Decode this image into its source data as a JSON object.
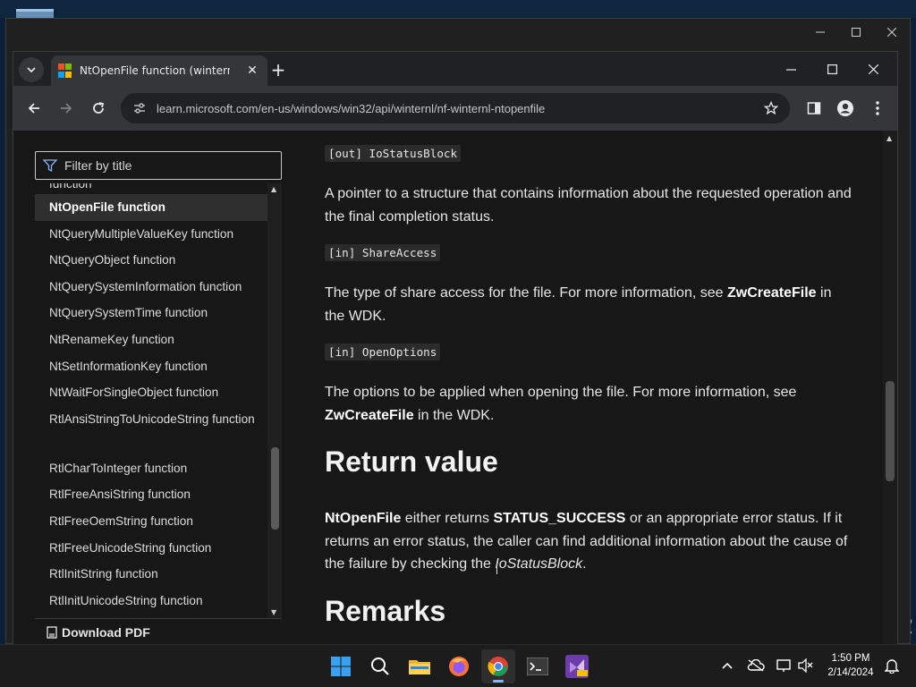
{
  "outer_window": {
    "controls": [
      "minimize-icon",
      "maximize-icon",
      "close-icon"
    ]
  },
  "browser": {
    "tab": {
      "title": "NtOpenFile function (winternl.h)",
      "close_glyph": "✕"
    },
    "new_tab_glyph": "+",
    "address": {
      "url": "learn.microsoft.com/en-us/windows/win32/api/winternl/nf-winternl-ntopenfile"
    }
  },
  "sidebar": {
    "filter_placeholder": "Filter by title",
    "items": [
      {
        "label": "function",
        "state": "partial"
      },
      {
        "label": "NtOpenFile function",
        "state": "active"
      },
      {
        "label": "NtQueryMultipleValueKey function",
        "state": "normal"
      },
      {
        "label": "NtQueryObject function",
        "state": "normal"
      },
      {
        "label": "NtQuerySystemInformation function",
        "state": "normal"
      },
      {
        "label": "NtQuerySystemTime function",
        "state": "normal"
      },
      {
        "label": "NtRenameKey function",
        "state": "normal"
      },
      {
        "label": "NtSetInformationKey function",
        "state": "normal"
      },
      {
        "label": "NtWaitForSingleObject function",
        "state": "normal"
      },
      {
        "label": "RtlAnsiStringToUnicodeString function",
        "state": "twoline"
      },
      {
        "label": "RtlCharToInteger function",
        "state": "normal"
      },
      {
        "label": "RtlFreeAnsiString function",
        "state": "normal"
      },
      {
        "label": "RtlFreeOemString function",
        "state": "normal"
      },
      {
        "label": "RtlFreeUnicodeString function",
        "state": "normal"
      },
      {
        "label": "RtlInitString function",
        "state": "normal"
      },
      {
        "label": "RtlInitUnicodeString function",
        "state": "normal"
      }
    ],
    "download_pdf": "Download PDF"
  },
  "article": {
    "params": [
      {
        "tag": "[out] IoStatusBlock"
      },
      {
        "tag": "[in] ShareAccess"
      },
      {
        "tag": "[in] OpenOptions"
      }
    ],
    "io_status_desc": "A pointer to a structure that contains information about the requested operation and the final completion status.",
    "share_access_desc": {
      "pre": "The type of share access for the file. For more information, see ",
      "link": "ZwCreateFile",
      "post": " in the WDK."
    },
    "open_options_desc": {
      "pre": "The options to be applied when opening the file. For more information, see ",
      "link": "ZwCreateFile",
      "post": " in the WDK."
    },
    "return_heading": "Return value",
    "return_desc": {
      "b1": "NtOpenFile",
      "t1": " either returns ",
      "b2": "STATUS_SUCCESS",
      "t2": " or an appropriate error status. If it returns an error status, the caller can find additional information about the cause of the failure by checking the ",
      "i1": "IoStatusBlock",
      "t3": "."
    },
    "remarks_heading": "Remarks"
  },
  "desktop": {
    "edge_text_line1": "ew",
    "edge_text_line2": "157"
  },
  "taskbar": {
    "time": "1:50 PM",
    "date": "2/14/2024",
    "apps": [
      "windows-start-icon",
      "search-icon",
      "file-explorer-icon",
      "firefox-icon",
      "chrome-icon",
      "terminal-icon",
      "visual-studio-icon"
    ]
  },
  "colors": {
    "page_bg": "#171717",
    "chrome_toolbar": "#35363a",
    "accent": "#8ab4f8"
  }
}
